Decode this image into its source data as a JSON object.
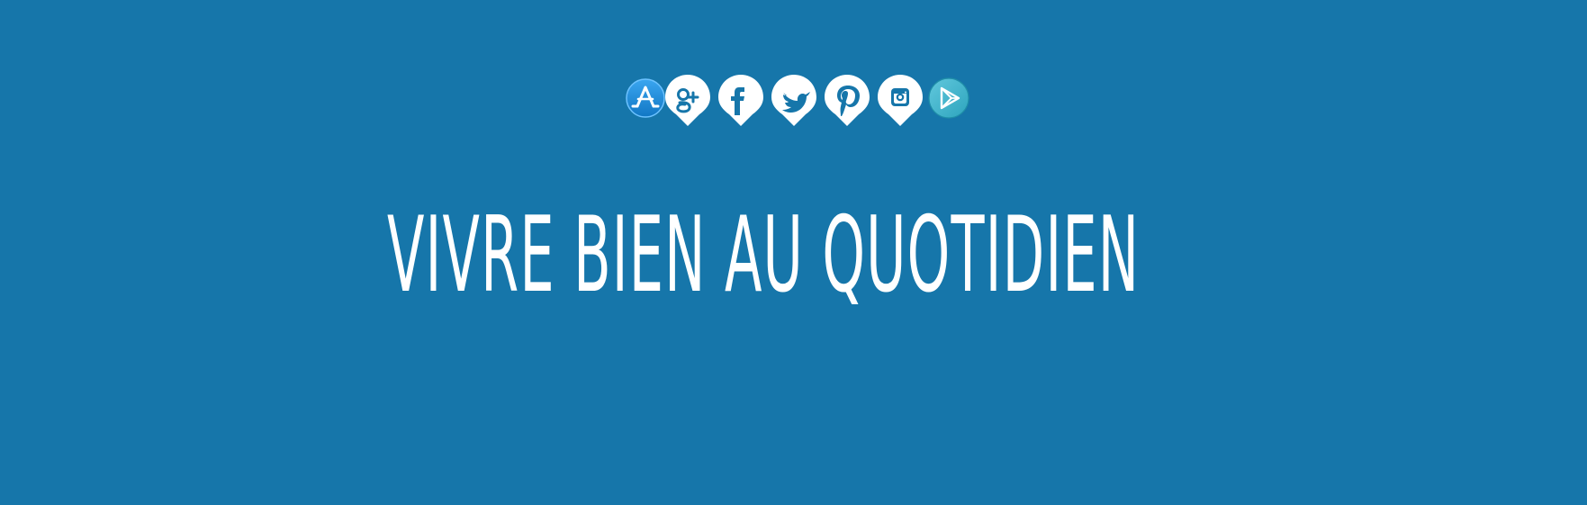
{
  "social": {
    "items": [
      {
        "name": "app-store-icon",
        "label": "App Store",
        "color": "#2d95e4"
      },
      {
        "name": "google-plus-icon",
        "label": "Google+",
        "color": "#ffffff"
      },
      {
        "name": "facebook-icon",
        "label": "Facebook",
        "color": "#ffffff"
      },
      {
        "name": "twitter-icon",
        "label": "Twitter",
        "color": "#ffffff"
      },
      {
        "name": "pinterest-icon",
        "label": "Pinterest",
        "color": "#ffffff"
      },
      {
        "name": "instagram-icon",
        "label": "Instagram",
        "color": "#ffffff"
      },
      {
        "name": "google-play-icon",
        "label": "Google Play",
        "color": "#43b8cf"
      }
    ],
    "accent": "#1676aa"
  },
  "hero": {
    "title": "VIVRE BIEN AU QUOTIDIEN",
    "text_color": "#ffffff",
    "background_color": "#1676aa"
  }
}
